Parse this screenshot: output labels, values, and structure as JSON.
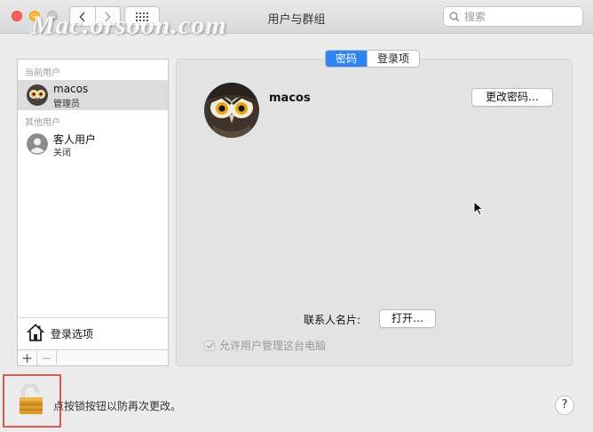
{
  "window": {
    "title": "用户与群组",
    "watermark": "Mac.orsoon.com",
    "search_placeholder": "搜索"
  },
  "sidebar": {
    "current_users_label": "当前用户",
    "other_users_label": "其他用户",
    "users": [
      {
        "name": "macos",
        "role": "管理员"
      },
      {
        "name": "客人用户",
        "role": "关闭"
      }
    ],
    "login_options_label": "登录选项",
    "add_label": "+",
    "remove_label": "−"
  },
  "tabs": [
    {
      "label": "密码",
      "active": true
    },
    {
      "label": "登录项",
      "active": false
    }
  ],
  "detail": {
    "user_name": "macos",
    "change_password_label": "更改密码…",
    "contact_card_label": "联系人名片:",
    "open_label": "打开…",
    "allow_admin_label": "允许用户管理这台电脑"
  },
  "footer": {
    "lock_message": "点按锁按钮以防再次更改。",
    "help_label": "?"
  },
  "colors": {
    "accent": "#2f84f4",
    "close": "#fc5f57",
    "minimize": "#fdbc2e",
    "highlight": "#e8534a"
  }
}
